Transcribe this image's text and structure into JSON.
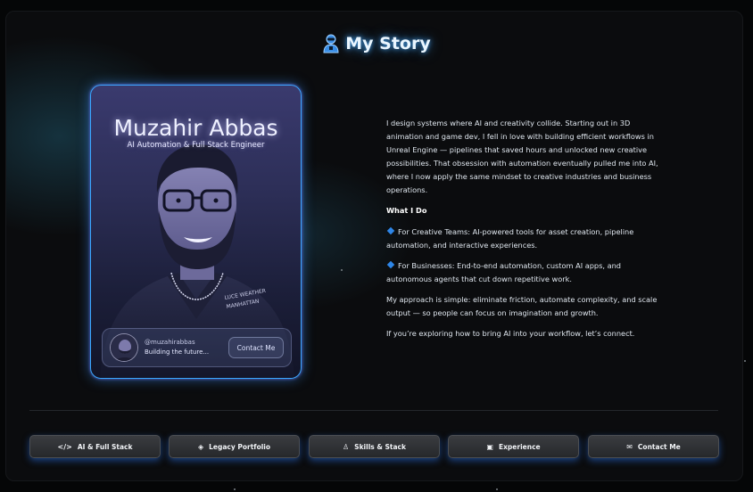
{
  "header": {
    "title": "My Story",
    "icon": "user-story-icon",
    "accent": "#46aaff"
  },
  "profile_card": {
    "name": "Muzahir Abbas",
    "role": "AI Automation & Full Stack Engineer",
    "handle": "@muzahirabbas",
    "status": "Building the future...",
    "contact_label": "Contact Me",
    "border_color": "#3aa7ff"
  },
  "story": {
    "intro": "I design systems where AI and creativity collide. Starting out in 3D animation and game dev, I fell in love with building efficient workflows in Unreal Engine — pipelines that saved hours and unlocked new creative possibilities. That obsession with automation eventually pulled me into AI, where I now apply the same mindset to creative industries and business operations.",
    "what_i_do_heading": "What I Do",
    "bullets": [
      "For Creative Teams: AI-powered tools for asset creation, pipeline automation, and interactive experiences.",
      "For Businesses: End-to-end automation, custom AI apps, and autonomous agents that cut down repetitive work."
    ],
    "approach": "My approach is simple: eliminate friction, automate complexity, and scale output — so people can focus on imagination and growth.",
    "closing": "If you’re exploring how to bring AI into your workflow, let’s connect.",
    "bullet_color": "#2e86e8"
  },
  "nav": {
    "items": [
      {
        "label": "AI & Full Stack",
        "icon": "code-icon",
        "glyph": "</>"
      },
      {
        "label": "Legacy Portfolio",
        "icon": "cube-icon",
        "glyph": "◈"
      },
      {
        "label": "Skills & Stack",
        "icon": "award-icon",
        "glyph": "♙"
      },
      {
        "label": "Experience",
        "icon": "briefcase-icon",
        "glyph": "▣"
      },
      {
        "label": "Contact Me",
        "icon": "envelope-icon",
        "glyph": "✉"
      }
    ],
    "glow_color": "#286edc"
  }
}
